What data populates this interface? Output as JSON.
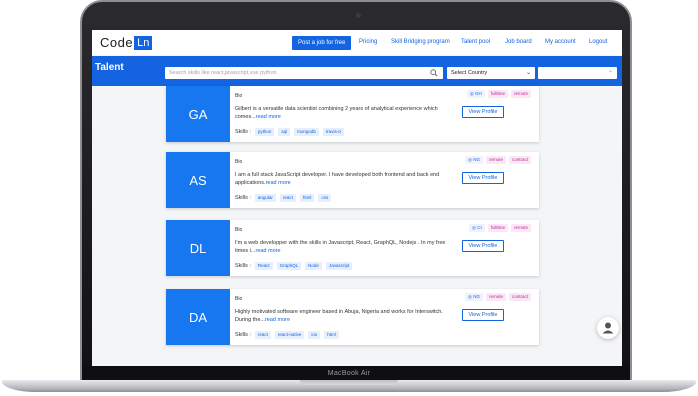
{
  "device": {
    "model_label": "MacBook Air"
  },
  "nav": {
    "logo_word": "Code",
    "logo_box": "Ln",
    "post_job": "Post a job for free",
    "links": [
      "Pricing",
      "Skill Bridging program",
      "Talent pool",
      "Job board",
      "My account",
      "Logout"
    ]
  },
  "talent": {
    "title": "Talent",
    "search_placeholder": "Search skills like react,javascript,vue python",
    "country_select": "Select Country"
  },
  "colors": {
    "brand": "#1463e0",
    "card_tile": "#1677f0",
    "type_tag": "#c0299a"
  },
  "cards": [
    {
      "initials": "GA",
      "bio_label": "Bio",
      "bio": "Gilbert is a versatile data scientist combining 2 years of analytical experience which comes...",
      "read_more": "read more",
      "skills_label": "Skills :",
      "skills": [
        "python",
        "sql",
        "mongodb",
        "travis-ci"
      ],
      "location": "GH",
      "types": [
        "fulltime",
        "remote"
      ],
      "view_profile": "View Profile"
    },
    {
      "initials": "AS",
      "bio_label": "Bio",
      "bio": "I am a full stack JavaScript developer. I have developed both frontend and back end applications.",
      "read_more": "read more",
      "skills_label": "Skills :",
      "skills": [
        "angular",
        "react",
        "html",
        "css"
      ],
      "location": "NG",
      "types": [
        "remote",
        "contract"
      ],
      "view_profile": "View Profile"
    },
    {
      "initials": "DL",
      "bio_label": "Bio",
      "bio": "I'm a web developper with the skills in Javascript, React, GraphQL, Nodejs . In my free times i...",
      "read_more": "read more",
      "skills_label": "Skills :",
      "skills": [
        "React",
        "GraphQL",
        "Node",
        "Javascript"
      ],
      "location": "CI",
      "types": [
        "fulltime",
        "remote"
      ],
      "view_profile": "View Profile"
    },
    {
      "initials": "DA",
      "bio_label": "Bio",
      "bio": "Highly motivated software engineer based in Abuja, Nigeria and works for Interswitch. During the...",
      "read_more": "read more",
      "skills_label": "Skills :",
      "skills": [
        "react",
        "react-native",
        "ios",
        "html"
      ],
      "location": "NG",
      "types": [
        "remote",
        "contract"
      ],
      "view_profile": "View Profile"
    }
  ]
}
